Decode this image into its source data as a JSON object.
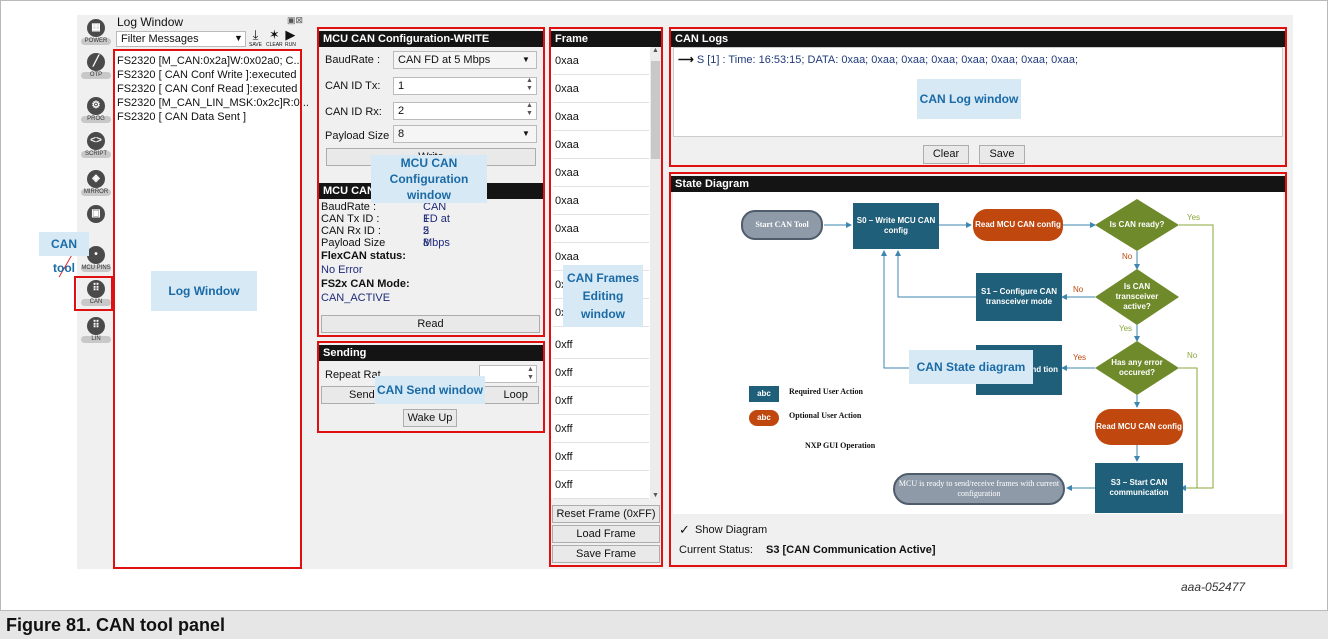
{
  "sidebar": {
    "items": [
      {
        "label": "POWER",
        "icon": "power-icon"
      },
      {
        "label": "OTP",
        "icon": "wand-icon"
      },
      {
        "label": "PROG",
        "icon": "gears-icon"
      },
      {
        "label": "SCRIPT",
        "icon": "code-icon"
      },
      {
        "label": "MIRROR",
        "icon": "mirror-icon"
      },
      {
        "label": "",
        "icon": "box-icon"
      },
      {
        "label": "MCU PINS",
        "icon": "pin-icon"
      },
      {
        "label": "CAN",
        "icon": "can-icon"
      },
      {
        "label": "LIN",
        "icon": "lin-icon"
      }
    ]
  },
  "log_window": {
    "title": "Log Window",
    "filter": "Filter Messages",
    "toolbar": {
      "save": "SAVE",
      "clear": "CLEAR",
      "run": "RUN"
    },
    "entries": [
      "FS2320 [M_CAN:0x2a]W:0x02a0; C...",
      "FS2320 [ CAN Conf Write ]:executed",
      "FS2320 [ CAN Conf Read ]:executed",
      "FS2320 [M_CAN_LIN_MSK:0x2c]R:0...",
      "FS2320 [ CAN Data Sent ]"
    ]
  },
  "config_write": {
    "title": "MCU CAN Configuration-WRITE",
    "baudrate_label": "BaudRate :",
    "baudrate_value": "CAN FD at 5 Mbps",
    "tx_label": "CAN ID Tx:",
    "tx_value": "1",
    "rx_label": "CAN ID Rx:",
    "rx_value": "2",
    "payload_label": "Payload Size",
    "payload_value": "8",
    "write_button": "Write"
  },
  "config_read": {
    "title": "MCU CAN",
    "baudrate_label": "BaudRate :",
    "baudrate_value": "CAN FD at 5 Mbps",
    "tx_label": "CAN Tx ID :",
    "tx_value": "1",
    "rx_label": "CAN Rx ID :",
    "rx_value": "2",
    "payload_label": "Payload Size",
    "payload_value": "8",
    "flexcan_label": "FlexCAN status:",
    "flexcan_value": "No Error",
    "mode_label": "FS2x CAN Mode:",
    "mode_value": "CAN_ACTIVE",
    "read_button": "Read"
  },
  "sending": {
    "title": "Sending",
    "repeat_label": "Repeat Rat",
    "send_button": "Send",
    "loop_button": "Loop",
    "wakeup_button": "Wake Up"
  },
  "frame": {
    "title": "Frame",
    "cells": [
      "0xaa",
      "0xaa",
      "0xaa",
      "0xaa",
      "0xaa",
      "0xaa",
      "0xaa",
      "0xaa",
      "0x",
      "0x",
      "0xff",
      "0xff",
      "0xff",
      "0xff",
      "0xff",
      "0xff"
    ],
    "reset_button": "Reset Frame (0xFF)",
    "load_button": "Load Frame",
    "save_button": "Save Frame"
  },
  "can_logs": {
    "title": "CAN Logs",
    "entry": "S [1] : Time: 16:53:15; DATA: 0xaa; 0xaa; 0xaa; 0xaa; 0xaa; 0xaa; 0xaa; 0xaa;",
    "clear_button": "Clear",
    "save_button": "Save"
  },
  "state_diagram": {
    "title": "State Diagram",
    "nodes": {
      "start": "Start CAN Tool",
      "s0": "S0 – Write MCU CAN config",
      "read1": "Read MCU CAN config",
      "ready_q": "Is CAN ready?",
      "s1": "S1 – Configure CAN transceiver mode",
      "trx_q": "Is CAN transceiver active?",
      "s2": "vice nd tion",
      "err_q": "Has any error occured?",
      "read2": "Read MCU CAN config",
      "s3": "S3 – Start CAN communication",
      "done": "MCU is ready to send/receive frames with current configuration"
    },
    "edges": {
      "yes": "Yes",
      "no": "No"
    },
    "legend": [
      {
        "sample": "abc",
        "text": "Required User Action"
      },
      {
        "sample": "abc",
        "text": "Optional User Action"
      },
      {
        "sample": "abc",
        "text": "NXP GUI Operation"
      }
    ],
    "show_diagram": "Show Diagram",
    "status_label": "Current Status:",
    "status_value": "S3 [CAN Communication Active]"
  },
  "callouts": {
    "can_tool": "CAN tool",
    "log_window": "Log Window",
    "config_window": "MCU CAN Configuration window",
    "send_window": "CAN Send window",
    "frames_window": "CAN Frames Editing window",
    "log_view": "CAN Log window",
    "state_diagram": "CAN State diagram"
  },
  "figure": {
    "code": "aaa-052477",
    "caption": "Figure 81.  CAN tool panel"
  },
  "colors": {
    "required": "#1f5f7a",
    "optional": "#c0470e",
    "nxp_gui": "#6f8a2a",
    "callout_bg": "#d6e9f5",
    "callout_text": "#1a6aa6",
    "highlight": "#e01010"
  }
}
